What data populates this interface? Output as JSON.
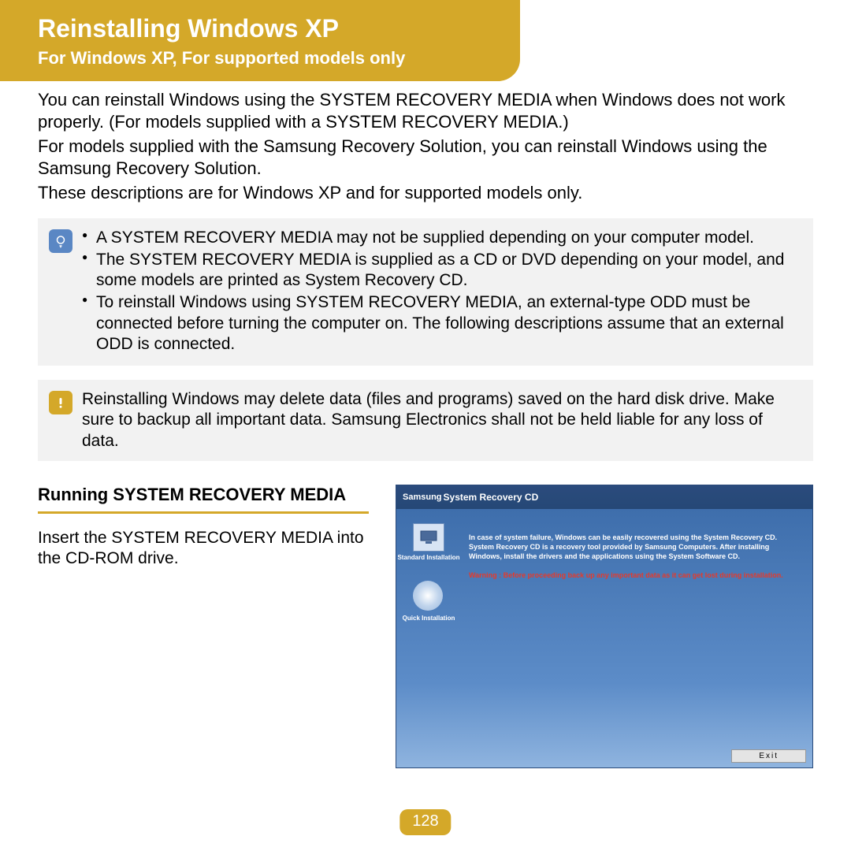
{
  "header": {
    "title": "Reinstalling Windows XP",
    "subtitle": "For Windows XP, For supported models only"
  },
  "intro": {
    "p1": "You can reinstall Windows using the SYSTEM RECOVERY MEDIA when Windows does not work properly. (For models supplied with a SYSTEM RECOVERY MEDIA.)",
    "p2": "For models supplied with the Samsung Recovery Solution, you can reinstall Windows using the Samsung Recovery Solution.",
    "p3": "These descriptions are for Windows XP and for supported models only."
  },
  "info_box": {
    "items": [
      "A SYSTEM RECOVERY MEDIA may not be supplied depending on your computer model.",
      "The SYSTEM RECOVERY MEDIA is supplied as a CD or DVD depending on your model, and some models are printed as System Recovery CD.",
      "To reinstall Windows using SYSTEM RECOVERY MEDIA, an external-type ODD must be connected before turning the computer on. The following descriptions assume that an external ODD is connected."
    ]
  },
  "warn_box": {
    "text": "Reinstalling Windows may delete data (files and programs) saved on the hard disk drive. Make sure to backup all important data. Samsung Electronics shall not be held liable for any loss of data."
  },
  "section": {
    "heading": "Running SYSTEM RECOVERY MEDIA",
    "text": "Insert the SYSTEM RECOVERY MEDIA into the CD-ROM drive."
  },
  "screenshot": {
    "brand": "Samsung",
    "title": "System Recovery CD",
    "options": {
      "standard": "Standard Installation",
      "quick": "Quick Installation"
    },
    "desc": "In case of system failure, Windows can be easily recovered using the System Recovery CD. System Recovery CD is a recovery tool provided by Samsung Computers. After installing Windows, install the drivers and the applications using the System Software CD.",
    "warning": "Warning : Before proceeding back up any important data as it can get lost during installation.",
    "exit": "Exit"
  },
  "page_number": "128"
}
